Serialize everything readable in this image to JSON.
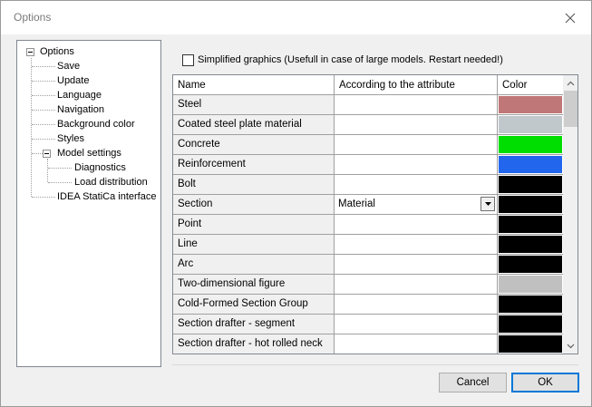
{
  "window": {
    "title": "Options"
  },
  "tree": {
    "root": "Options",
    "items": [
      "Save",
      "Update",
      "Language",
      "Navigation",
      "Background color",
      "Styles"
    ],
    "model_settings": "Model settings",
    "model_children": [
      "Diagnostics",
      "Load distribution"
    ],
    "last": "IDEA StatiCa interface"
  },
  "simplified": {
    "label": "Simplified graphics (Usefull in case of large models. Restart needed!)",
    "checked": false
  },
  "grid": {
    "headers": {
      "name": "Name",
      "attr": "According to the attribute",
      "color": "Color"
    },
    "rows": [
      {
        "name": "Steel",
        "attr": "",
        "color": "#c07777"
      },
      {
        "name": "Coated steel plate material",
        "attr": "",
        "color": "#c0c8cc"
      },
      {
        "name": "Concrete",
        "attr": "",
        "color": "#00dd00"
      },
      {
        "name": "Reinforcement",
        "attr": "",
        "color": "#2266ee"
      },
      {
        "name": "Bolt",
        "attr": "",
        "color": "#000000"
      },
      {
        "name": "Section",
        "attr": "Material",
        "color": "#000000",
        "dropdown": true
      },
      {
        "name": "Point",
        "attr": "",
        "color": "#000000"
      },
      {
        "name": "Line",
        "attr": "",
        "color": "#000000"
      },
      {
        "name": "Arc",
        "attr": "",
        "color": "#000000"
      },
      {
        "name": "Two-dimensional figure",
        "attr": "",
        "color": "#c0c0c0"
      },
      {
        "name": "Cold-Formed Section Group",
        "attr": "",
        "color": "#000000"
      },
      {
        "name": "Section drafter - segment",
        "attr": "",
        "color": "#000000"
      },
      {
        "name": "Section drafter - hot rolled neck",
        "attr": "",
        "color": "#000000"
      }
    ]
  },
  "buttons": {
    "cancel": "Cancel",
    "ok": "OK"
  }
}
